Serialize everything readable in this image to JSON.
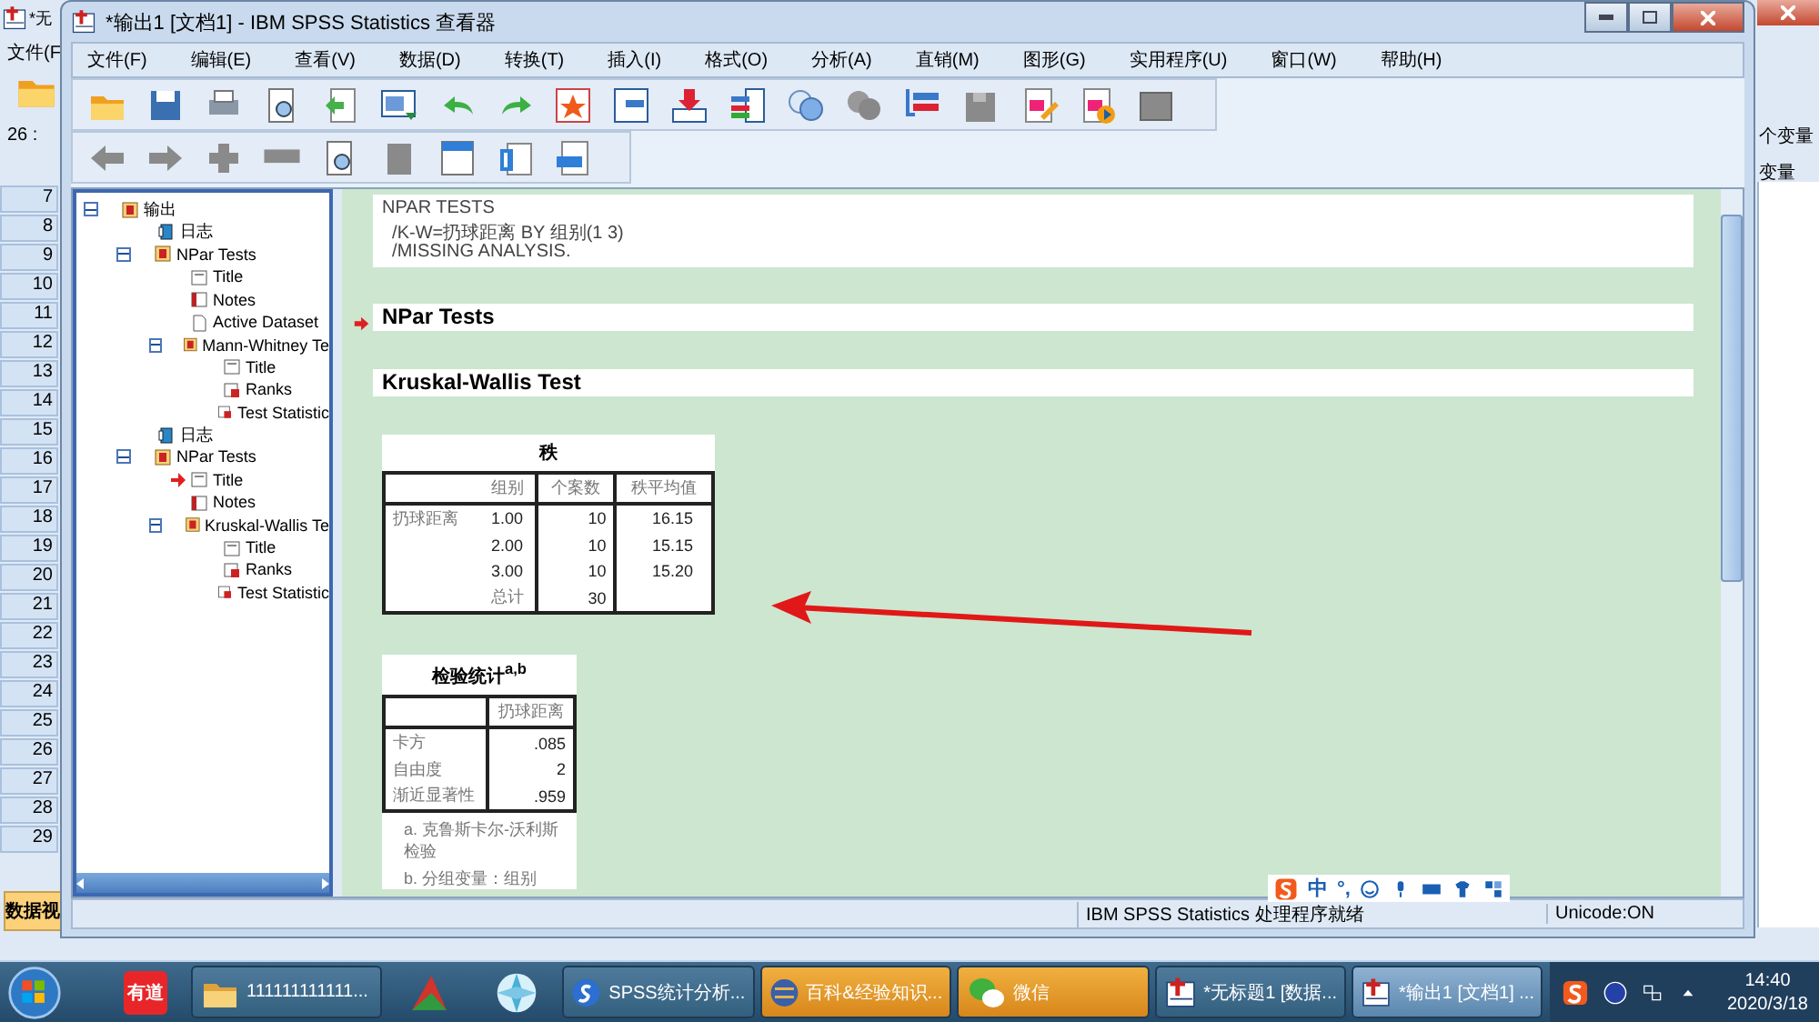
{
  "background_window": {
    "title": "*无",
    "menu": "文件(F",
    "cell_ref": "26 :",
    "right_label": "个变量",
    "column_header": "变量",
    "row_numbers": [
      "7",
      "8",
      "9",
      "10",
      "11",
      "12",
      "13",
      "14",
      "15",
      "16",
      "17",
      "18",
      "19",
      "20",
      "21",
      "22",
      "23",
      "24",
      "25",
      "26",
      "27",
      "28",
      "29"
    ],
    "tab": "数据视"
  },
  "window": {
    "title": "*输出1 [文档1] - IBM SPSS Statistics 查看器"
  },
  "menu": [
    "文件(F)",
    "编辑(E)",
    "查看(V)",
    "数据(D)",
    "转换(T)",
    "插入(I)",
    "格式(O)",
    "分析(A)",
    "直销(M)",
    "图形(G)",
    "实用程序(U)",
    "窗口(W)",
    "帮助(H)"
  ],
  "outline": [
    {
      "label": "输出",
      "kind": "folder",
      "expanded": true,
      "selected": false,
      "children": [
        {
          "label": "日志",
          "kind": "log",
          "selected": false
        },
        {
          "label": "NPar Tests",
          "kind": "folder",
          "expanded": true,
          "selected": false,
          "children": [
            {
              "label": "Title",
              "kind": "title",
              "selected": false
            },
            {
              "label": "Notes",
              "kind": "notes",
              "selected": false
            },
            {
              "label": "Active Dataset",
              "kind": "dataset",
              "selected": false
            },
            {
              "label": "Mann-Whitney Te",
              "kind": "folder",
              "expanded": true,
              "selected": false,
              "children": [
                {
                  "label": "Title",
                  "kind": "title",
                  "selected": false
                },
                {
                  "label": "Ranks",
                  "kind": "table",
                  "selected": false
                },
                {
                  "label": "Test Statistic",
                  "kind": "table",
                  "selected": false
                }
              ]
            }
          ]
        },
        {
          "label": "日志",
          "kind": "log",
          "selected": false
        },
        {
          "label": "NPar Tests",
          "kind": "folder",
          "expanded": true,
          "selected": false,
          "children": [
            {
              "label": "Title",
              "kind": "title",
              "selected": true
            },
            {
              "label": "Notes",
              "kind": "notes",
              "selected": false
            },
            {
              "label": "Kruskal-Wallis Te",
              "kind": "folder",
              "expanded": true,
              "selected": false,
              "children": [
                {
                  "label": "Title",
                  "kind": "title",
                  "selected": false
                },
                {
                  "label": "Ranks",
                  "kind": "table",
                  "selected": false
                },
                {
                  "label": "Test Statistic",
                  "kind": "table",
                  "selected": false
                }
              ]
            }
          ]
        }
      ]
    }
  ],
  "output": {
    "syntax": [
      "NPAR TESTS",
      "  /K-W=扔球距离 BY 组别(1 3)",
      "  /MISSING ANALYSIS."
    ],
    "headings": [
      {
        "text": "NPar Tests",
        "selected": true
      },
      {
        "text": "Kruskal-Wallis Test",
        "selected": false
      }
    ],
    "ranks_table": {
      "title": "秩",
      "columns": [
        "",
        "组别",
        "个案数",
        "秩平均值"
      ],
      "rows": [
        [
          "扔球距离",
          "1.00",
          "10",
          "16.15"
        ],
        [
          "",
          "2.00",
          "10",
          "15.15"
        ],
        [
          "",
          "3.00",
          "10",
          "15.20"
        ],
        [
          "",
          "总计",
          "30",
          ""
        ]
      ]
    },
    "stats_table": {
      "title": "检验统计$^{a,b}$",
      "columns": [
        "",
        "扔球距离"
      ],
      "rows": [
        [
          "卡方",
          ".085"
        ],
        [
          "自由度",
          "2"
        ],
        [
          "渐近显著性",
          ".959"
        ]
      ],
      "footnotes": [
        "a. 克鲁斯卡尔-沃利斯检验",
        "b. 分组变量：组别"
      ]
    }
  },
  "ime_bar": {
    "mode": "中",
    "punctuation": "°,"
  },
  "status_bar": {
    "message": "IBM SPSS Statistics 处理程序就绪",
    "encoding": "Unicode:ON"
  },
  "taskbar": {
    "items": [
      {
        "kind": "text_icon",
        "label": "有道"
      },
      {
        "kind": "button",
        "label": "111111111111...",
        "flashing": false,
        "selected": false
      },
      {
        "kind": "icon"
      },
      {
        "kind": "icon"
      },
      {
        "kind": "button",
        "label": "SPSS统计分析...",
        "flashing": false,
        "selected": false
      },
      {
        "kind": "button",
        "label": "百科&经验知识...",
        "flashing": true,
        "selected": false
      },
      {
        "kind": "button",
        "label": "微信",
        "flashing": true,
        "selected": false
      },
      {
        "kind": "button",
        "label": "*无标题1 [数据...",
        "flashing": false,
        "selected": false
      },
      {
        "kind": "button",
        "label": "*输出1 [文档1] ...",
        "flashing": false,
        "selected": true
      }
    ],
    "clock": {
      "time": "14:40",
      "date": "2020/3/18"
    }
  }
}
